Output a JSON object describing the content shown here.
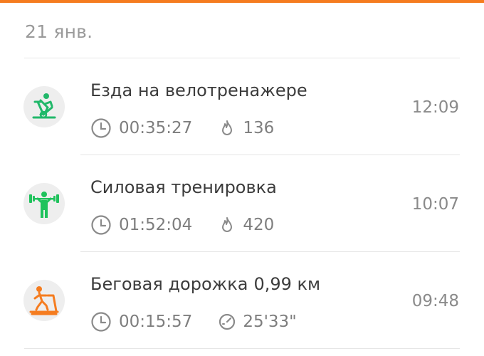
{
  "date_header": "21 янв.",
  "colors": {
    "accent": "#f57c1f",
    "cycling_icon": "#21b86a",
    "strength_icon": "#1fc25c",
    "treadmill_icon": "#f57c1f"
  },
  "activities": [
    {
      "icon": "stationary-bike-icon",
      "title": "Езда на велотренажере",
      "distance": "",
      "duration": "00:35:27",
      "metric_icon": "flame-icon",
      "metric_value": "136",
      "time": "12:09"
    },
    {
      "icon": "weightlifting-icon",
      "title": "Силовая тренировка",
      "distance": "",
      "duration": "01:52:04",
      "metric_icon": "flame-icon",
      "metric_value": "420",
      "time": "10:07"
    },
    {
      "icon": "treadmill-icon",
      "title": "Беговая дорожка",
      "distance": "0,99 км",
      "duration": "00:15:57",
      "metric_icon": "pace-icon",
      "metric_value": "25'33\"",
      "time": "09:48"
    }
  ]
}
